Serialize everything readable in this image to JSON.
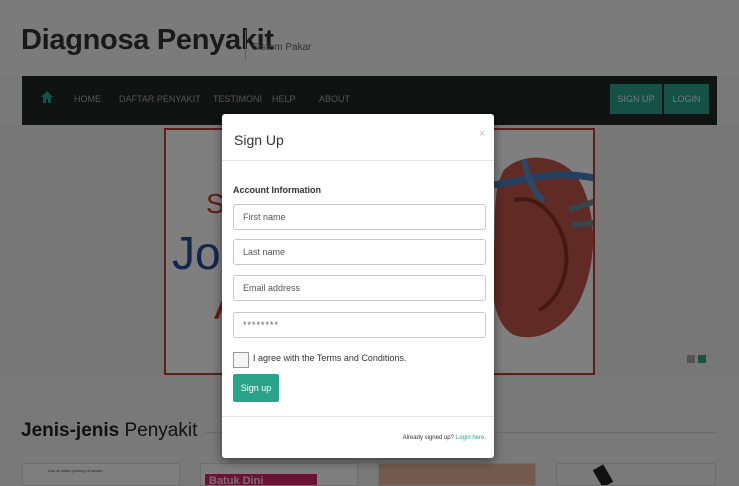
{
  "site": {
    "title": "Diagnosa Penyakit",
    "subtitle": "Sistem Pakar"
  },
  "nav": {
    "items": [
      "HOME",
      "DAFTAR PENYAKIT",
      "TESTIMONI",
      "HELP",
      "ABOUT"
    ],
    "signup_label": "SIGN UP",
    "login_label": "LOGIN"
  },
  "banner": {
    "text_s": "S",
    "text_jo": "Jo",
    "text_red": "A"
  },
  "section": {
    "title_bold": "Jenis-jenis",
    "title_rest": " Penyakit"
  },
  "thumbs": {
    "first_text": "Ada di dalam jantung di bawah",
    "second_text": "Batuk Dini"
  },
  "modal": {
    "title": "Sign Up",
    "close": "×",
    "section_label": "Account Information",
    "first_name_placeholder": "First name",
    "last_name_placeholder": "Last name",
    "email_placeholder": "Email address",
    "password_value": "********",
    "agree_text": "I agree with the Terms and Conditions.",
    "signup_button": "Sign up",
    "footer_text": "Already signed up?",
    "footer_link": "Login here."
  },
  "colors": {
    "accent": "#2aa38a",
    "navbar": "#1f2622",
    "banner_border": "#c9382e"
  },
  "icons": [
    "home-icon"
  ]
}
